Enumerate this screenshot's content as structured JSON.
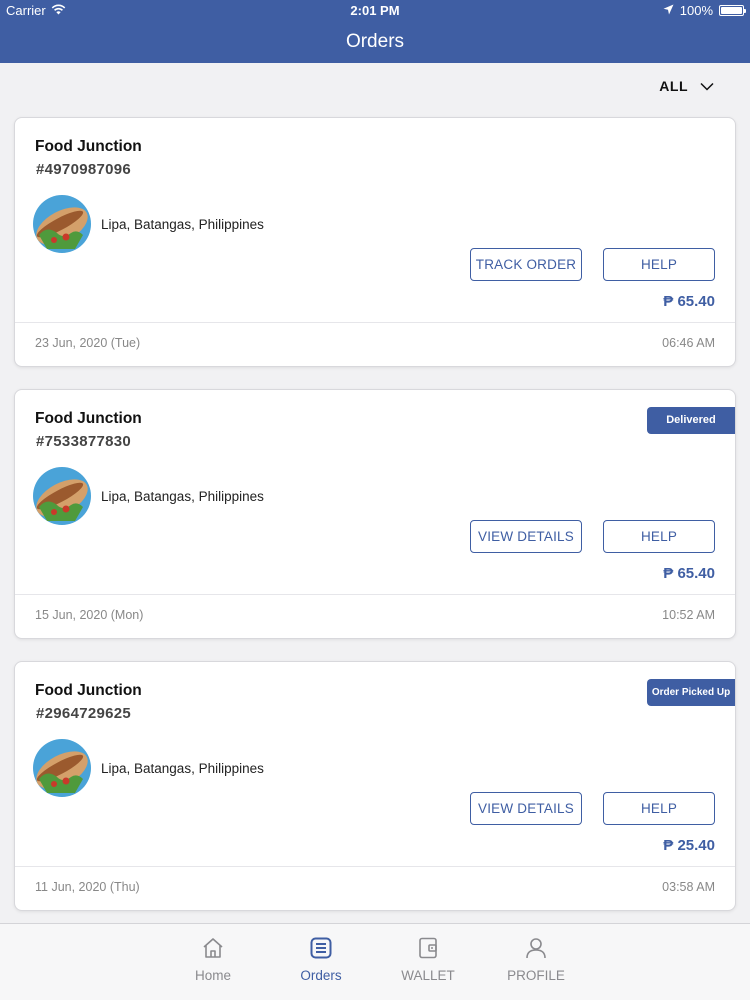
{
  "status_bar": {
    "carrier": "Carrier",
    "time": "2:01 PM",
    "battery": "100%"
  },
  "header": {
    "title": "Orders"
  },
  "filter": {
    "label": "ALL"
  },
  "colors": {
    "accent": "#3f5ea3",
    "background": "#f1f1f3"
  },
  "orders": [
    {
      "restaurant": "Food Junction",
      "order_id": "#4970987096",
      "address": "Lipa, Batangas, Philippines",
      "primary_action": "TRACK ORDER",
      "help_action": "HELP",
      "price": "₱ 65.40",
      "date": "23 Jun, 2020 (Tue)",
      "time": "06:46 AM",
      "status": ""
    },
    {
      "restaurant": "Food Junction",
      "order_id": "#7533877830",
      "address": "Lipa, Batangas, Philippines",
      "primary_action": "VIEW DETAILS",
      "help_action": "HELP",
      "price": "₱ 65.40",
      "date": "15 Jun, 2020 (Mon)",
      "time": "10:52 AM",
      "status": "Delivered"
    },
    {
      "restaurant": "Food Junction",
      "order_id": "#2964729625",
      "address": "Lipa, Batangas, Philippines",
      "primary_action": "VIEW DETAILS",
      "help_action": "HELP",
      "price": "₱ 25.40",
      "date": "11 Jun, 2020 (Thu)",
      "time": "03:58 AM",
      "status": "Order Picked Up"
    }
  ],
  "tabs": [
    {
      "label": "Home",
      "icon": "home-icon",
      "active": false
    },
    {
      "label": "Orders",
      "icon": "orders-icon",
      "active": true
    },
    {
      "label": "WALLET",
      "icon": "wallet-icon",
      "active": false
    },
    {
      "label": "PROFILE",
      "icon": "profile-icon",
      "active": false
    }
  ]
}
